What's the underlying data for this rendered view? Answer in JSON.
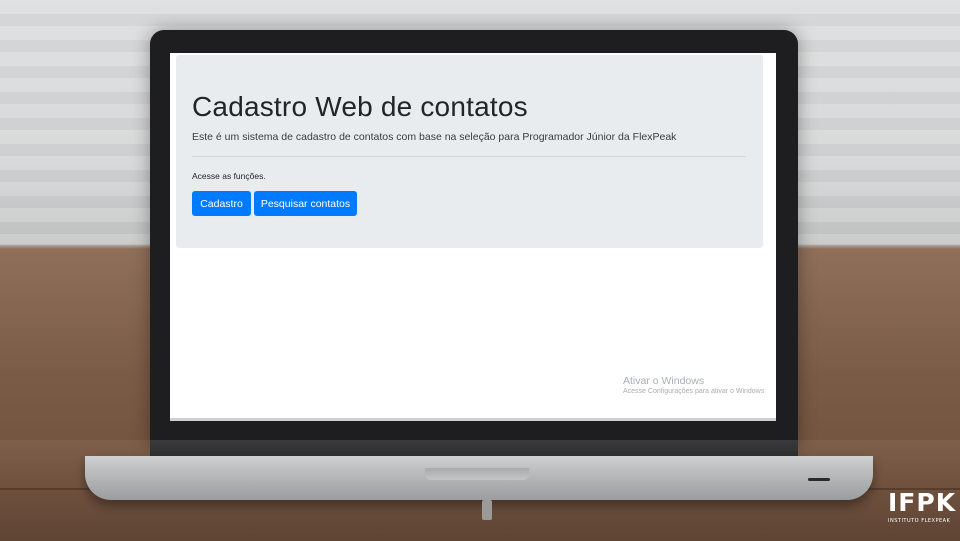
{
  "screen": {
    "page_title": "Cadastro Web de contatos",
    "lead_text": "Este é um sistema de cadastro de contatos com base na seleção para Programador Júnior da FlexPeak",
    "hint_text": "Acesse as funções.",
    "buttons": {
      "cadastro": "Cadastro",
      "pesquisar": "Pesquisar contatos"
    },
    "watermark": {
      "title": "Ativar o Windows",
      "subtitle": "Acesse Configurações para ativar o Windows"
    }
  },
  "logo": {
    "main": "IFPK",
    "sub": "INSTITUTO FLEXPEAK"
  },
  "colors": {
    "primary_button": "#007bff",
    "jumbotron_bg": "#e9ecef"
  }
}
